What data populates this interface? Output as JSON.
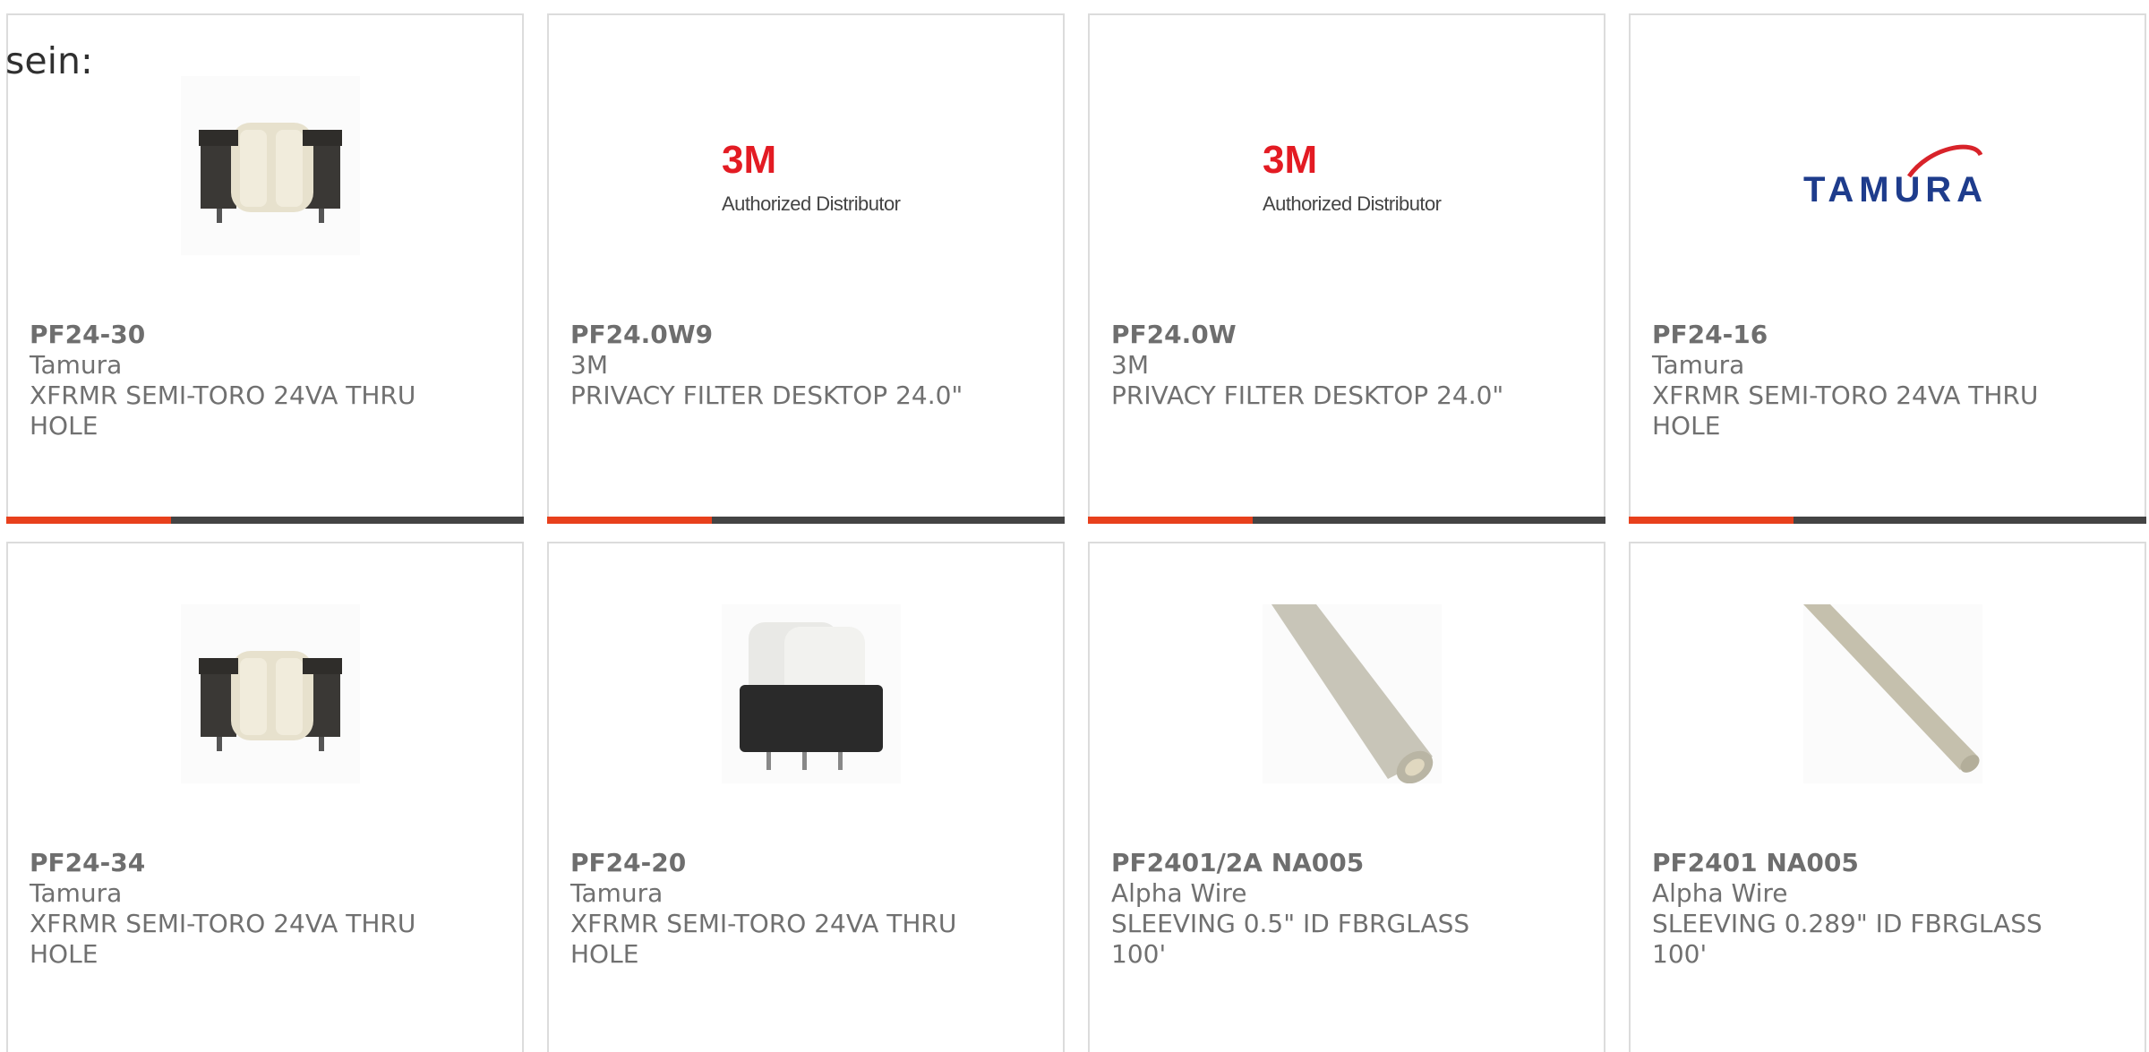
{
  "page": {
    "heading": "sein:",
    "accent_color": "#e8401c",
    "bar_color": "#444444",
    "border_color": "#dcdcdc"
  },
  "products": [
    {
      "part_number": "PF24-30",
      "manufacturer": "Tamura",
      "description": "XFRMR SEMI-TORO 24VA THRU HOLE",
      "image": "transformer-icon"
    },
    {
      "part_number": "PF24.0W9",
      "manufacturer": "3M",
      "description": "PRIVACY FILTER DESKTOP 24.0\"",
      "image": "3m-logo",
      "logo_text": "3M",
      "logo_subtext": "Authorized Distributor"
    },
    {
      "part_number": "PF24.0W",
      "manufacturer": "3M",
      "description": "PRIVACY FILTER DESKTOP 24.0\"",
      "image": "3m-logo",
      "logo_text": "3M",
      "logo_subtext": "Authorized Distributor"
    },
    {
      "part_number": "PF24-16",
      "manufacturer": "Tamura",
      "description": "XFRMR SEMI-TORO 24VA THRU HOLE",
      "image": "tamura-logo",
      "logo_text": "TAMURA"
    },
    {
      "part_number": "PF24-34",
      "manufacturer": "Tamura",
      "description": "XFRMR SEMI-TORO 24VA THRU HOLE",
      "image": "transformer-icon"
    },
    {
      "part_number": "PF24-20",
      "manufacturer": "Tamura",
      "description": "XFRMR SEMI-TORO 24VA THRU HOLE",
      "image": "transformer-upright-icon"
    },
    {
      "part_number": "PF2401/2A NA005",
      "manufacturer": "Alpha Wire",
      "description": "SLEEVING 0.5\" ID FBRGLASS 100'",
      "image": "sleeving-thick-icon"
    },
    {
      "part_number": "PF2401 NA005",
      "manufacturer": "Alpha Wire",
      "description": "SLEEVING 0.289\" ID FBRGLASS 100'",
      "image": "sleeving-thin-icon"
    }
  ]
}
